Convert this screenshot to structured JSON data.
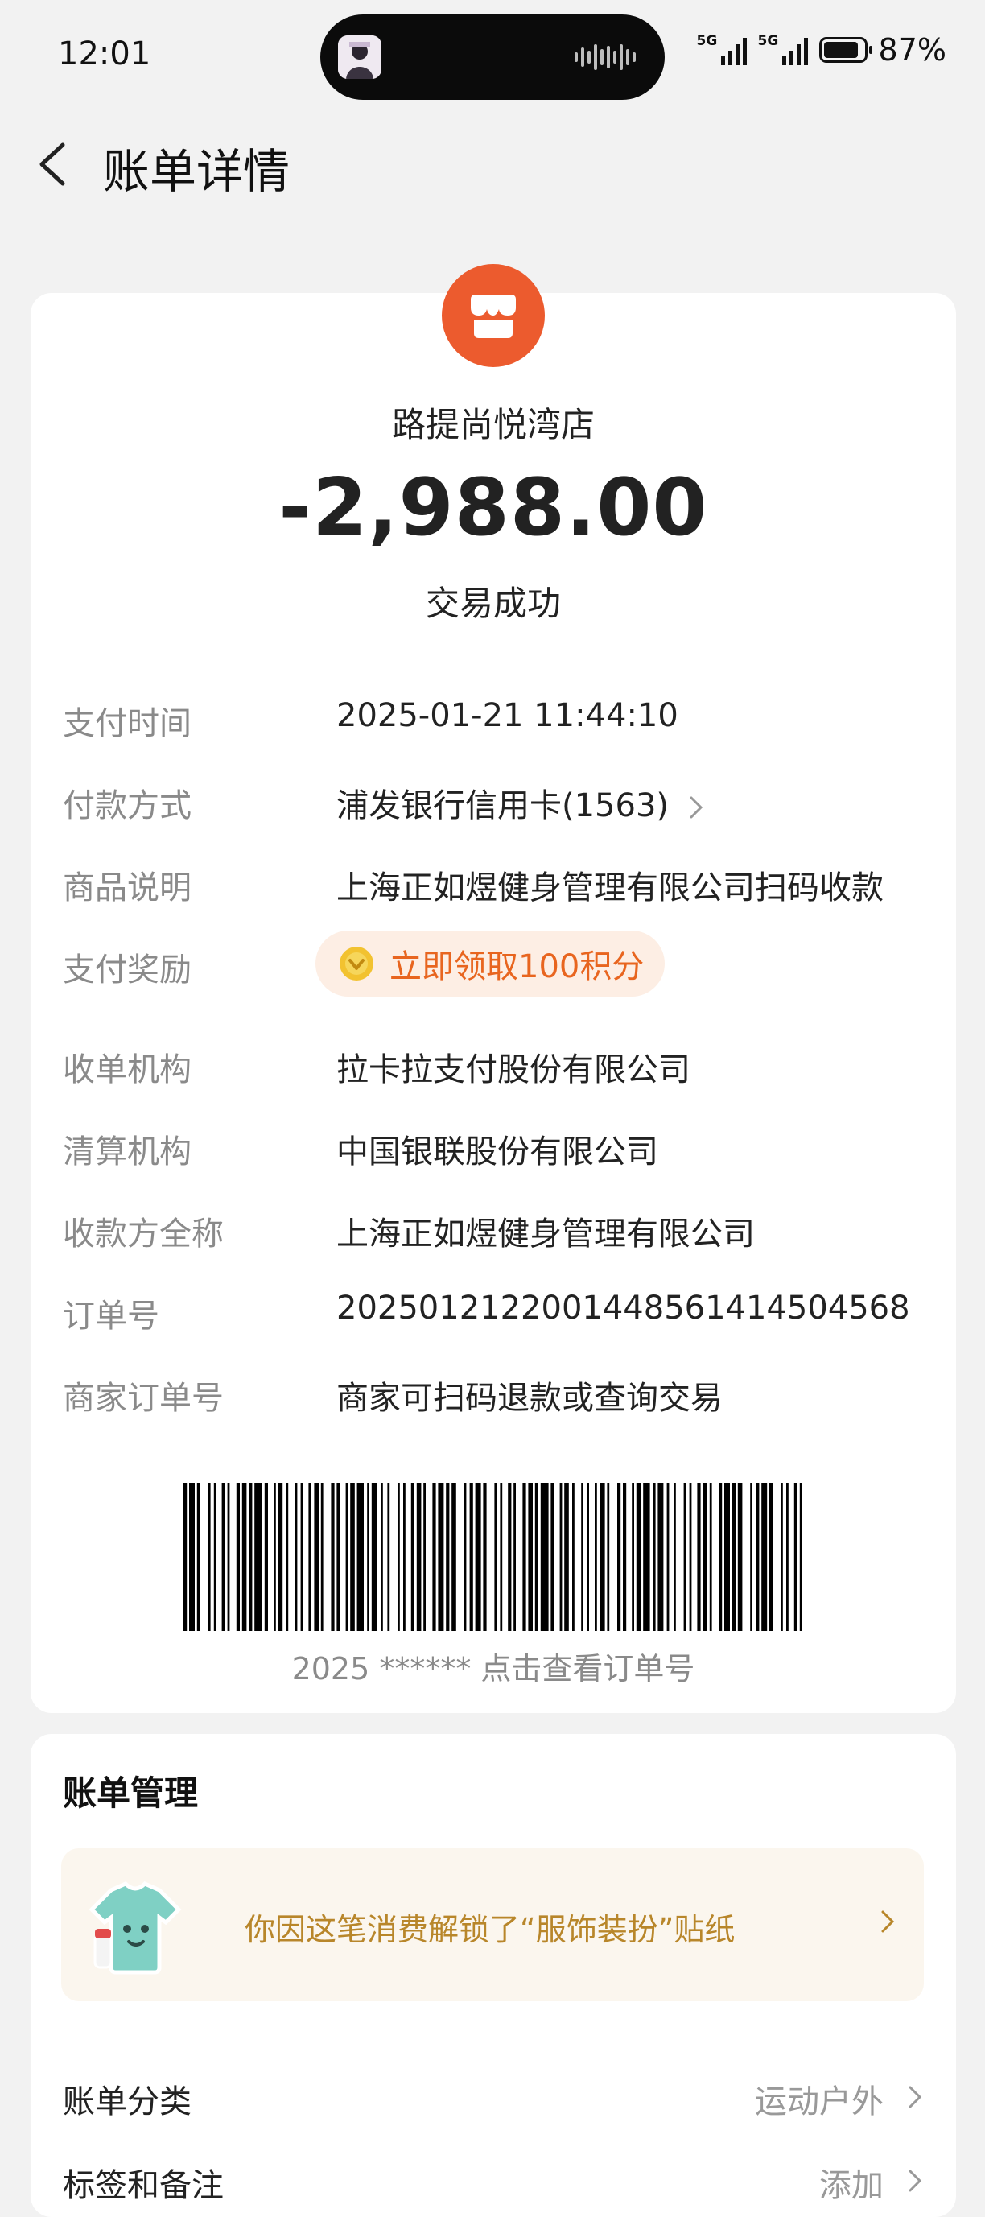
{
  "status_bar": {
    "time": "12:01",
    "battery_percent": "87%",
    "network": [
      "5G",
      "5G"
    ]
  },
  "header": {
    "title": "账单详情",
    "back_icon": "chevron-left-icon"
  },
  "transaction": {
    "merchant_name": "路提尚悦湾店",
    "amount": "-2,988.00",
    "status": "交易成功",
    "details": [
      {
        "label": "支付时间",
        "value": "2025-01-21 11:44:10"
      },
      {
        "label": "付款方式",
        "value": "浦发银行信用卡(1563)"
      },
      {
        "label": "商品说明",
        "value": "上海正如煜健身管理有限公司扫码收款"
      },
      {
        "label": "支付奖励",
        "value": "立即领取100积分"
      },
      {
        "label": "收单机构",
        "value": "拉卡拉支付股份有限公司"
      },
      {
        "label": "清算机构",
        "value": "中国银联股份有限公司"
      },
      {
        "label": "收款方全称",
        "value": "上海正如煜健身管理有限公司"
      },
      {
        "label": "订单号",
        "value": "2025012122001448561414504568"
      },
      {
        "label": "商家订单号",
        "value": "商家可扫码退款或查询交易"
      }
    ],
    "barcode_caption": "2025 ****** 点击查看订单号"
  },
  "bill_management": {
    "title": "账单管理",
    "banner_text": "你因这笔消费解锁了“服饰装扮”贴纸",
    "rows": [
      {
        "label": "账单分类",
        "value": "运动户外"
      },
      {
        "label": "标签和备注",
        "value": "添加"
      }
    ]
  },
  "colors": {
    "accent": "#ec5b2e",
    "reward_text": "#e8651f",
    "banner_text": "#b8862a",
    "background": "#f2f2f2"
  }
}
